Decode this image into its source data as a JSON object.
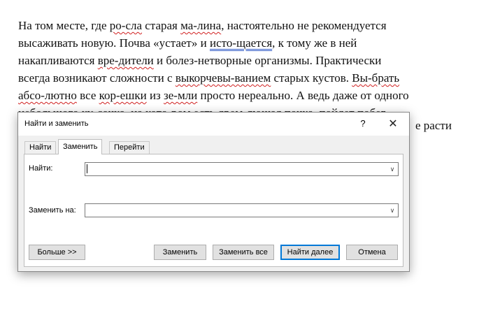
{
  "document": {
    "lines": [
      [
        {
          "t": "На том месте, где "
        },
        {
          "t": "ро-сла",
          "s": "red"
        },
        {
          "t": " старая "
        },
        {
          "t": "ма-лина",
          "s": "red"
        },
        {
          "t": ", настоятельно не рекомендуется"
        }
      ],
      [
        {
          "t": "высаживать новую. Почва «устает» и "
        },
        {
          "t": "исто-щается",
          "s": "blue"
        },
        {
          "t": ", к тому же в ней"
        }
      ],
      [
        {
          "t": "накапливаются "
        },
        {
          "t": "вре-дители",
          "s": "red"
        },
        {
          "t": " и болез-нетворные организмы. Практически"
        }
      ],
      [
        {
          "t": "всегда возникают сложности с "
        },
        {
          "t": "выкорчевы-ванием",
          "s": "red"
        },
        {
          "t": " старых кустов. "
        },
        {
          "t": "Вы-брать",
          "s": "red"
        }
      ],
      [
        {
          "t": "абсо-лютно",
          "s": "red"
        },
        {
          "t": " все "
        },
        {
          "t": "кор-ешки",
          "s": "red"
        },
        {
          "t": " из "
        },
        {
          "t": "зе-мли",
          "s": "red"
        },
        {
          "t": " просто нереально. А ведь даже от одного"
        }
      ],
      [
        {
          "t": "небольшого "
        },
        {
          "t": "ку-сочка",
          "s": "red"
        },
        {
          "t": ", на кото-ром есть дрем-лющая почка, пойдет побег."
        }
      ]
    ],
    "hidden_fragment": "е расти"
  },
  "dialog": {
    "title": "Найти и заменить",
    "help_label": "?",
    "close_label": "✕",
    "tabs": [
      "Найти",
      "Заменить",
      "Перейти"
    ],
    "active_tab": "Заменить",
    "find_label": "Найти:",
    "find_value": "",
    "replace_label": "Заменить на:",
    "replace_value": "",
    "dropdown_glyph": "∨",
    "buttons": {
      "more": "Больше >>",
      "replace": "Заменить",
      "replace_all": "Заменить все",
      "find_next": "Найти далее",
      "cancel": "Отмена"
    }
  }
}
